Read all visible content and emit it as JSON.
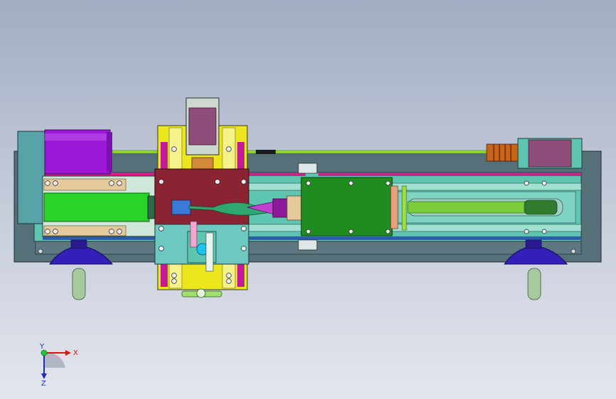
{
  "view": {
    "background_top": "#a2acc3",
    "background_bottom": "#e3e6ed"
  },
  "colors": {
    "base": "#56707a",
    "frame": "#5ec6b0",
    "rail_magenta": "#d0208a",
    "motor_purple": "#9b18d6",
    "chuck_green": "#28d428",
    "tailstock_green": "#1f8c1f",
    "carriage_yellow": "#ece61e",
    "carriage_maroon": "#8a2433",
    "handwheel_blue": "#3320b8",
    "leadscrew": "#8ee01c",
    "coupling_orange": "#c8641a"
  },
  "triad": {
    "x_label": "X",
    "y_label": "Y",
    "z_label": "Z"
  }
}
